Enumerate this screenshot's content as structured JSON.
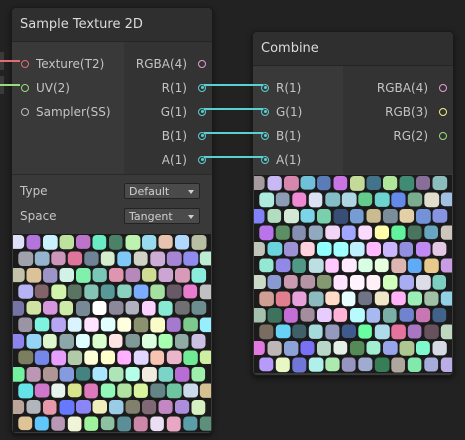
{
  "colors": {
    "background": "#222222",
    "node_body": "#393939",
    "node_title": "#2f2f2f",
    "wire": "#5ad1d1",
    "texture_port": "#e06c75",
    "uv_port": "#9bdc7a",
    "sampler_port": "#bdbdbd",
    "rgba_port": "#e79cd6",
    "rgb_port": "#f2ef8a",
    "rg_port": "#9bdc7a",
    "float_port": "#5ad1d1"
  },
  "sample_node": {
    "title": "Sample Texture 2D",
    "inputs": [
      {
        "label": "Texture(T2)",
        "icon": "texture-port-icon"
      },
      {
        "label": "UV(2)",
        "icon": "uv-port-icon"
      },
      {
        "label": "Sampler(SS)",
        "icon": "sampler-port-icon"
      }
    ],
    "outputs": [
      {
        "label": "RGBA(4)"
      },
      {
        "label": "R(1)"
      },
      {
        "label": "G(1)"
      },
      {
        "label": "B(1)"
      },
      {
        "label": "A(1)"
      }
    ],
    "settings": [
      {
        "label": "Type",
        "value": "Default"
      },
      {
        "label": "Space",
        "value": "Tangent"
      }
    ],
    "preview": "voronoi-texture-preview"
  },
  "combine_node": {
    "title": "Combine",
    "inputs": [
      {
        "label": "R(1)"
      },
      {
        "label": "G(1)"
      },
      {
        "label": "B(1)"
      },
      {
        "label": "A(1)"
      }
    ],
    "outputs": [
      {
        "label": "RGBA(4)"
      },
      {
        "label": "RGB(3)"
      },
      {
        "label": "RG(2)"
      }
    ],
    "preview": "voronoi-texture-preview"
  }
}
